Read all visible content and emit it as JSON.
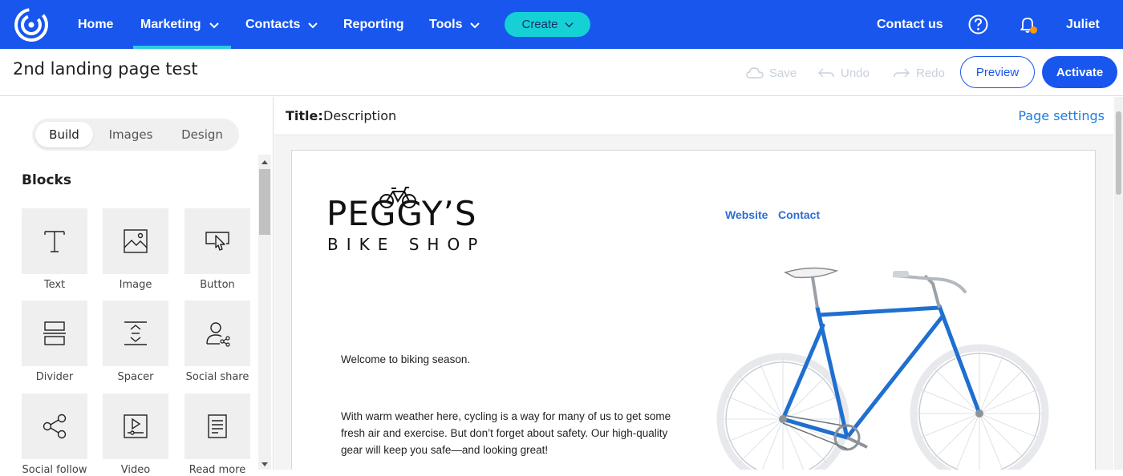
{
  "nav": {
    "items": [
      {
        "label": "Home"
      },
      {
        "label": "Marketing"
      },
      {
        "label": "Contacts"
      },
      {
        "label": "Reporting"
      },
      {
        "label": "Tools"
      }
    ],
    "create_label": "Create",
    "contact_us": "Contact us",
    "user": "Juliet",
    "notification_dot_color": "#ff9900",
    "accent": "#1856ed"
  },
  "toolbar": {
    "page_name": "2nd landing page test",
    "save_label": "Save",
    "undo_label": "Undo",
    "redo_label": "Redo",
    "preview_label": "Preview",
    "activate_label": "Activate"
  },
  "sidebar": {
    "tabs": [
      {
        "label": "Build",
        "active": true
      },
      {
        "label": "Images",
        "active": false
      },
      {
        "label": "Design",
        "active": false
      }
    ],
    "section_title": "Blocks",
    "blocks": [
      {
        "label": "Text",
        "icon": "text-icon"
      },
      {
        "label": "Image",
        "icon": "image-icon"
      },
      {
        "label": "Button",
        "icon": "button-icon"
      },
      {
        "label": "Divider",
        "icon": "divider-icon"
      },
      {
        "label": "Spacer",
        "icon": "spacer-icon"
      },
      {
        "label": "Social share",
        "icon": "social-share-icon"
      },
      {
        "label": "Social follow",
        "icon": "social-follow-icon"
      },
      {
        "label": "Video",
        "icon": "video-icon"
      },
      {
        "label": "Read more",
        "icon": "read-more-icon"
      }
    ]
  },
  "editor": {
    "title_key": "Title:",
    "title_value": "Description",
    "page_settings": "Page settings"
  },
  "landing": {
    "brand_top": "PEGGY’S",
    "brand_bottom": "BIKE SHOP",
    "links": [
      "Website",
      "Contact"
    ],
    "welcome": "Welcome to biking season.",
    "body_lines": [
      "With warm weather here, cycling is a way for many of us to get some",
      "fresh air and exercise. But don’t forget about safety. Our high-quality",
      "gear will keep you safe—and looking great!"
    ],
    "bike_color": "#1f6fd0"
  }
}
